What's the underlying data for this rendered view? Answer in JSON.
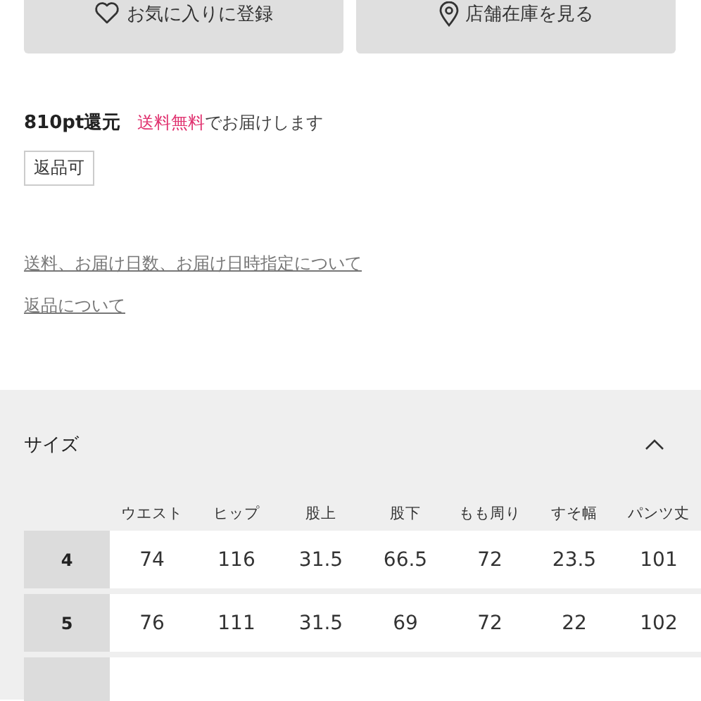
{
  "actions": [
    {
      "kind": "favorite",
      "label": "お気に入りに登録"
    },
    {
      "kind": "store",
      "label": "店舗在庫を見る"
    }
  ],
  "points": "810pt還元",
  "shipping": {
    "highlight": "送料無料",
    "rest": "でお届けします"
  },
  "tag": "返品可",
  "links": [
    "送料、お届け日数、お届け日時指定について",
    "返品について"
  ],
  "size_section": {
    "title": "サイズ",
    "expanded": true,
    "columns": [
      "ウエスト",
      "ヒップ",
      "股上",
      "股下",
      "もも周り",
      "すそ幅",
      "パンツ丈"
    ],
    "rows": [
      {
        "label": "4",
        "values": [
          "74",
          "116",
          "31.5",
          "66.5",
          "72",
          "23.5",
          "101"
        ]
      },
      {
        "label": "5",
        "values": [
          "76",
          "111",
          "31.5",
          "69",
          "72",
          "22",
          "102"
        ]
      }
    ]
  }
}
